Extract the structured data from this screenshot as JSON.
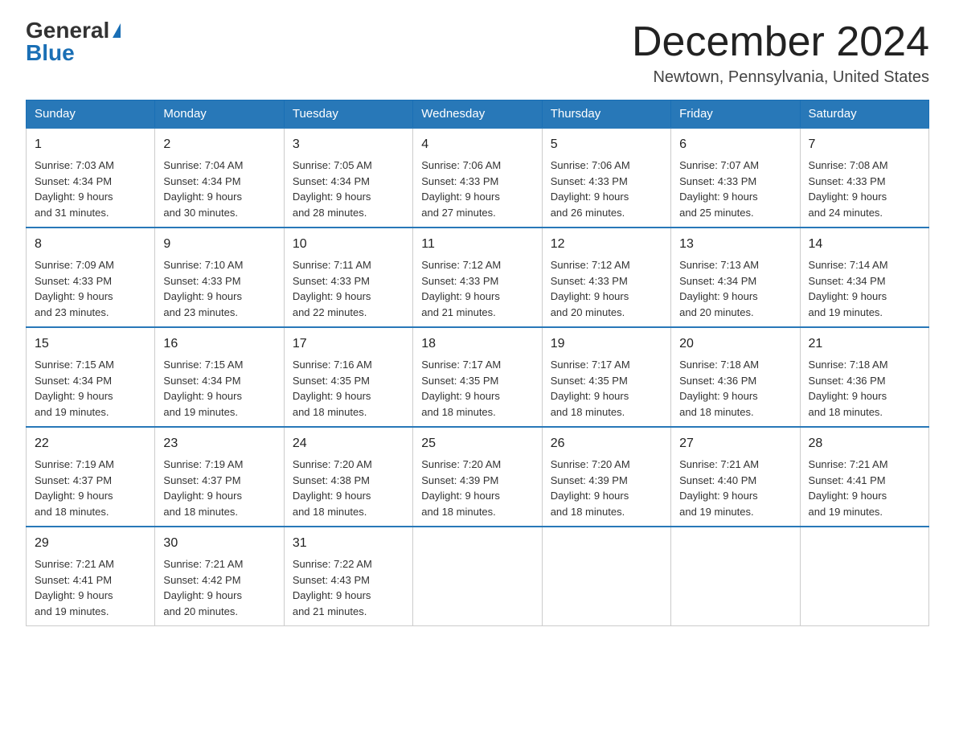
{
  "logo": {
    "general": "General",
    "blue": "Blue"
  },
  "title": "December 2024",
  "location": "Newtown, Pennsylvania, United States",
  "days_of_week": [
    "Sunday",
    "Monday",
    "Tuesday",
    "Wednesday",
    "Thursday",
    "Friday",
    "Saturday"
  ],
  "weeks": [
    [
      {
        "day": "1",
        "sunrise": "7:03 AM",
        "sunset": "4:34 PM",
        "daylight": "9 hours and 31 minutes."
      },
      {
        "day": "2",
        "sunrise": "7:04 AM",
        "sunset": "4:34 PM",
        "daylight": "9 hours and 30 minutes."
      },
      {
        "day": "3",
        "sunrise": "7:05 AM",
        "sunset": "4:34 PM",
        "daylight": "9 hours and 28 minutes."
      },
      {
        "day": "4",
        "sunrise": "7:06 AM",
        "sunset": "4:33 PM",
        "daylight": "9 hours and 27 minutes."
      },
      {
        "day": "5",
        "sunrise": "7:06 AM",
        "sunset": "4:33 PM",
        "daylight": "9 hours and 26 minutes."
      },
      {
        "day": "6",
        "sunrise": "7:07 AM",
        "sunset": "4:33 PM",
        "daylight": "9 hours and 25 minutes."
      },
      {
        "day": "7",
        "sunrise": "7:08 AM",
        "sunset": "4:33 PM",
        "daylight": "9 hours and 24 minutes."
      }
    ],
    [
      {
        "day": "8",
        "sunrise": "7:09 AM",
        "sunset": "4:33 PM",
        "daylight": "9 hours and 23 minutes."
      },
      {
        "day": "9",
        "sunrise": "7:10 AM",
        "sunset": "4:33 PM",
        "daylight": "9 hours and 23 minutes."
      },
      {
        "day": "10",
        "sunrise": "7:11 AM",
        "sunset": "4:33 PM",
        "daylight": "9 hours and 22 minutes."
      },
      {
        "day": "11",
        "sunrise": "7:12 AM",
        "sunset": "4:33 PM",
        "daylight": "9 hours and 21 minutes."
      },
      {
        "day": "12",
        "sunrise": "7:12 AM",
        "sunset": "4:33 PM",
        "daylight": "9 hours and 20 minutes."
      },
      {
        "day": "13",
        "sunrise": "7:13 AM",
        "sunset": "4:34 PM",
        "daylight": "9 hours and 20 minutes."
      },
      {
        "day": "14",
        "sunrise": "7:14 AM",
        "sunset": "4:34 PM",
        "daylight": "9 hours and 19 minutes."
      }
    ],
    [
      {
        "day": "15",
        "sunrise": "7:15 AM",
        "sunset": "4:34 PM",
        "daylight": "9 hours and 19 minutes."
      },
      {
        "day": "16",
        "sunrise": "7:15 AM",
        "sunset": "4:34 PM",
        "daylight": "9 hours and 19 minutes."
      },
      {
        "day": "17",
        "sunrise": "7:16 AM",
        "sunset": "4:35 PM",
        "daylight": "9 hours and 18 minutes."
      },
      {
        "day": "18",
        "sunrise": "7:17 AM",
        "sunset": "4:35 PM",
        "daylight": "9 hours and 18 minutes."
      },
      {
        "day": "19",
        "sunrise": "7:17 AM",
        "sunset": "4:35 PM",
        "daylight": "9 hours and 18 minutes."
      },
      {
        "day": "20",
        "sunrise": "7:18 AM",
        "sunset": "4:36 PM",
        "daylight": "9 hours and 18 minutes."
      },
      {
        "day": "21",
        "sunrise": "7:18 AM",
        "sunset": "4:36 PM",
        "daylight": "9 hours and 18 minutes."
      }
    ],
    [
      {
        "day": "22",
        "sunrise": "7:19 AM",
        "sunset": "4:37 PM",
        "daylight": "9 hours and 18 minutes."
      },
      {
        "day": "23",
        "sunrise": "7:19 AM",
        "sunset": "4:37 PM",
        "daylight": "9 hours and 18 minutes."
      },
      {
        "day": "24",
        "sunrise": "7:20 AM",
        "sunset": "4:38 PM",
        "daylight": "9 hours and 18 minutes."
      },
      {
        "day": "25",
        "sunrise": "7:20 AM",
        "sunset": "4:39 PM",
        "daylight": "9 hours and 18 minutes."
      },
      {
        "day": "26",
        "sunrise": "7:20 AM",
        "sunset": "4:39 PM",
        "daylight": "9 hours and 18 minutes."
      },
      {
        "day": "27",
        "sunrise": "7:21 AM",
        "sunset": "4:40 PM",
        "daylight": "9 hours and 19 minutes."
      },
      {
        "day": "28",
        "sunrise": "7:21 AM",
        "sunset": "4:41 PM",
        "daylight": "9 hours and 19 minutes."
      }
    ],
    [
      {
        "day": "29",
        "sunrise": "7:21 AM",
        "sunset": "4:41 PM",
        "daylight": "9 hours and 19 minutes."
      },
      {
        "day": "30",
        "sunrise": "7:21 AM",
        "sunset": "4:42 PM",
        "daylight": "9 hours and 20 minutes."
      },
      {
        "day": "31",
        "sunrise": "7:22 AM",
        "sunset": "4:43 PM",
        "daylight": "9 hours and 21 minutes."
      },
      null,
      null,
      null,
      null
    ]
  ]
}
